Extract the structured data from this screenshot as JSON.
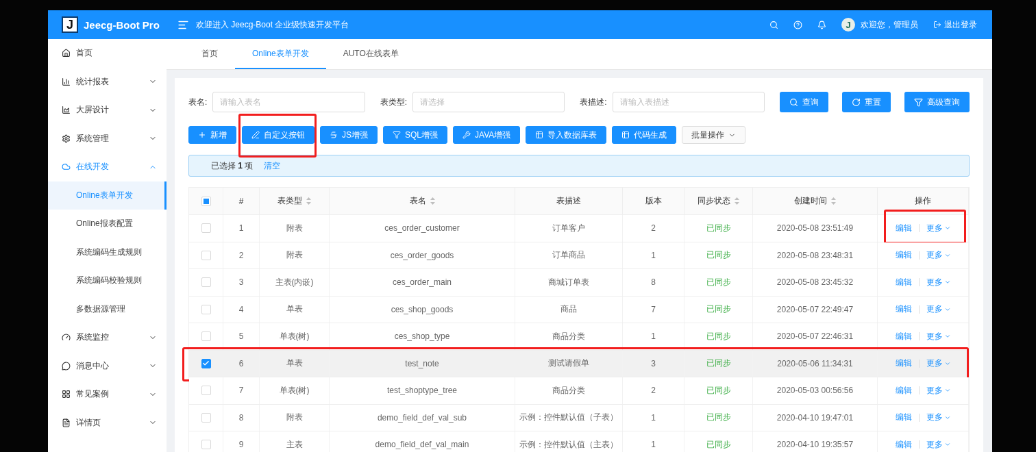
{
  "header": {
    "logo_letter": "J",
    "app_name": "Jeecg-Boot Pro",
    "welcome": "欢迎进入 Jeecg-Boot 企业级快速开发平台",
    "avatar_letter": "J",
    "user_greeting": "欢迎您，管理员",
    "logout": "退出登录"
  },
  "sidebar": {
    "items": [
      {
        "label": "首页",
        "selected": false
      },
      {
        "label": "统计报表",
        "expandable": true,
        "expanded": false,
        "selected": false
      },
      {
        "label": "大屏设计",
        "expandable": true,
        "expanded": false,
        "selected": false
      },
      {
        "label": "系统管理",
        "expandable": true,
        "expanded": false,
        "selected": false
      },
      {
        "label": "在线开发",
        "expandable": true,
        "expanded": true,
        "selected": true,
        "children": [
          {
            "label": "Online表单开发",
            "selected": true
          },
          {
            "label": "Online报表配置",
            "selected": false
          },
          {
            "label": "系统编码生成规则",
            "selected": false
          },
          {
            "label": "系统编码校验规则",
            "selected": false
          },
          {
            "label": "多数据源管理",
            "selected": false
          }
        ]
      },
      {
        "label": "系统监控",
        "expandable": true,
        "expanded": false,
        "selected": false
      },
      {
        "label": "消息中心",
        "expandable": true,
        "expanded": false,
        "selected": false
      },
      {
        "label": "常见案例",
        "expandable": true,
        "expanded": false,
        "selected": false
      },
      {
        "label": "详情页",
        "expandable": true,
        "expanded": false,
        "selected": false
      }
    ]
  },
  "tabs": [
    {
      "label": "首页",
      "selected": false
    },
    {
      "label": "Online表单开发",
      "selected": true
    },
    {
      "label": "AUTO在线表单",
      "selected": false
    }
  ],
  "filters": [
    {
      "label": "表名:",
      "placeholder": "请输入表名"
    },
    {
      "label": "表类型:",
      "placeholder": "请选择"
    },
    {
      "label": "表描述:",
      "placeholder": "请输入表描述"
    }
  ],
  "query_buttons": [
    "查询",
    "重置",
    "高级查询"
  ],
  "toolbar": [
    {
      "label": "新增",
      "kind": "primary",
      "highlighted": false
    },
    {
      "label": "自定义按钮",
      "kind": "primary",
      "highlighted": true
    },
    {
      "label": "JS增强",
      "kind": "primary",
      "highlighted": false
    },
    {
      "label": "SQL增强",
      "kind": "primary",
      "highlighted": false
    },
    {
      "label": "JAVA增强",
      "kind": "primary",
      "highlighted": false
    },
    {
      "label": "导入数据库表",
      "kind": "primary",
      "highlighted": false
    },
    {
      "label": "代码生成",
      "kind": "primary",
      "highlighted": false
    },
    {
      "label": "批量操作",
      "kind": "dropdown",
      "highlighted": false
    }
  ],
  "selection_alert": {
    "text": "已选择 **1** 项",
    "clear": "清空"
  },
  "table": {
    "select_all": {
      "checked": false,
      "indeterminate": true
    },
    "columns": [
      {
        "label": "#",
        "sortable": false
      },
      {
        "label": "表类型",
        "sortable": true
      },
      {
        "label": "表名",
        "sortable": true
      },
      {
        "label": "表描述",
        "sortable": false
      },
      {
        "label": "版本",
        "sortable": false
      },
      {
        "label": "同步状态",
        "sortable": true
      },
      {
        "label": "创建时间",
        "sortable": true
      },
      {
        "label": "操作",
        "sortable": false
      }
    ],
    "rows": [
      {
        "num": "1",
        "type": "附表",
        "name": "ces_order_customer",
        "desc": "订单客户",
        "version": "2",
        "sync": "已同步",
        "created": "2020-05-08 23:51:49",
        "edit": "编辑",
        "more": "更多",
        "checked": false,
        "highlighted": false,
        "actions_highlighted": true
      },
      {
        "num": "2",
        "type": "附表",
        "name": "ces_order_goods",
        "desc": "订单商品",
        "version": "1",
        "sync": "已同步",
        "created": "2020-05-08 23:48:31",
        "edit": "编辑",
        "more": "更多",
        "checked": false,
        "highlighted": false,
        "actions_highlighted": false
      },
      {
        "num": "3",
        "type": "主表(内嵌)",
        "name": "ces_order_main",
        "desc": "商城订单表",
        "version": "8",
        "sync": "已同步",
        "created": "2020-05-08 23:45:32",
        "edit": "编辑",
        "more": "更多",
        "checked": false,
        "highlighted": false,
        "actions_highlighted": false
      },
      {
        "num": "4",
        "type": "单表",
        "name": "ces_shop_goods",
        "desc": "商品",
        "version": "7",
        "sync": "已同步",
        "created": "2020-05-07 22:49:47",
        "edit": "编辑",
        "more": "更多",
        "checked": false,
        "highlighted": false,
        "actions_highlighted": false
      },
      {
        "num": "5",
        "type": "单表(树)",
        "name": "ces_shop_type",
        "desc": "商品分类",
        "version": "1",
        "sync": "已同步",
        "created": "2020-05-07 22:46:31",
        "edit": "编辑",
        "more": "更多",
        "checked": false,
        "highlighted": false,
        "actions_highlighted": false
      },
      {
        "num": "6",
        "type": "单表",
        "name": "test_note",
        "desc": "测试请假单",
        "version": "3",
        "sync": "已同步",
        "created": "2020-05-06 11:34:31",
        "edit": "编辑",
        "more": "更多",
        "checked": true,
        "highlighted": true,
        "actions_highlighted": false
      },
      {
        "num": "7",
        "type": "单表(树)",
        "name": "test_shoptype_tree",
        "desc": "商品分类",
        "version": "2",
        "sync": "已同步",
        "created": "2020-05-03 00:56:56",
        "edit": "编辑",
        "more": "更多",
        "checked": false,
        "highlighted": false,
        "actions_highlighted": false
      },
      {
        "num": "8",
        "type": "附表",
        "name": "demo_field_def_val_sub",
        "desc": "示例：控件默认值（子表）",
        "version": "1",
        "sync": "已同步",
        "created": "2020-04-10 19:47:01",
        "edit": "编辑",
        "more": "更多",
        "checked": false,
        "highlighted": false,
        "actions_highlighted": false
      },
      {
        "num": "9",
        "type": "主表",
        "name": "demo_field_def_val_main",
        "desc": "示例：控件默认值（主表）",
        "version": "1",
        "sync": "已同步",
        "created": "2020-04-10 19:35:57",
        "edit": "编辑",
        "more": "更多",
        "checked": false,
        "highlighted": false,
        "actions_highlighted": false
      }
    ]
  }
}
